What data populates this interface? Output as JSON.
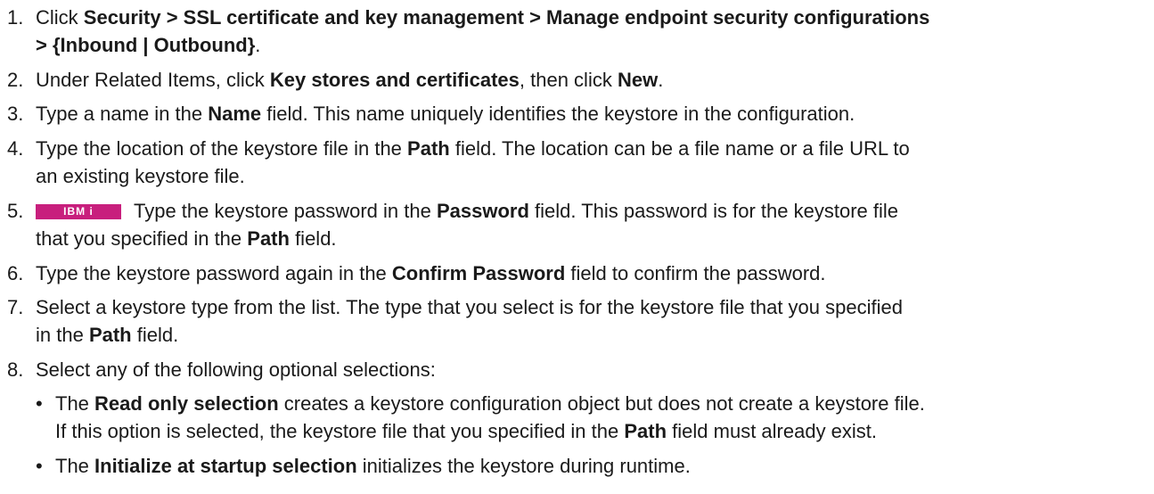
{
  "steps": [
    {
      "num": "1.",
      "parts": [
        {
          "t": "Click ",
          "b": false
        },
        {
          "t": "Security > SSL certificate and key management > Manage endpoint security configurations",
          "b": true
        }
      ],
      "line2": [
        {
          "t": "> {Inbound | Outbound}",
          "b": true
        },
        {
          "t": ".",
          "b": false
        }
      ]
    },
    {
      "num": "2.",
      "parts": [
        {
          "t": "Under Related Items, click ",
          "b": false
        },
        {
          "t": "Key stores and certificates",
          "b": true
        },
        {
          "t": ", then click ",
          "b": false
        },
        {
          "t": "New",
          "b": true
        },
        {
          "t": ".",
          "b": false
        }
      ]
    },
    {
      "num": "3.",
      "parts": [
        {
          "t": "Type a name in the ",
          "b": false
        },
        {
          "t": "Name",
          "b": true
        },
        {
          "t": " field. This name uniquely identifies the keystore in the configuration.",
          "b": false
        }
      ]
    },
    {
      "num": "4.",
      "parts": [
        {
          "t": "Type the location of the keystore file in the ",
          "b": false
        },
        {
          "t": "Path",
          "b": true
        },
        {
          "t": " field. The location can be a file name or a file URL to",
          "b": false
        }
      ],
      "line2": [
        {
          "t": "an existing keystore file.",
          "b": false
        }
      ]
    },
    {
      "num": "5.",
      "badge": "IBM i",
      "parts": [
        {
          "t": "Type the keystore password in the ",
          "b": false
        },
        {
          "t": "Password",
          "b": true
        },
        {
          "t": " field. This password is for the keystore file",
          "b": false
        }
      ],
      "line2": [
        {
          "t": "that you specified in the ",
          "b": false
        },
        {
          "t": "Path",
          "b": true
        },
        {
          "t": " field.",
          "b": false
        }
      ]
    },
    {
      "num": "6.",
      "parts": [
        {
          "t": "Type the keystore password again in the ",
          "b": false
        },
        {
          "t": "Confirm Password",
          "b": true
        },
        {
          "t": " field to confirm the password.",
          "b": false
        }
      ]
    },
    {
      "num": "7.",
      "parts": [
        {
          "t": "Select a keystore type from the list. The type that you select is for the keystore file that you specified",
          "b": false
        }
      ],
      "line2": [
        {
          "t": "in the ",
          "b": false
        },
        {
          "t": "Path",
          "b": true
        },
        {
          "t": " field.",
          "b": false
        }
      ]
    },
    {
      "num": "8.",
      "parts": [
        {
          "t": "Select any of the following optional selections:",
          "b": false
        }
      ]
    }
  ],
  "bullets": [
    {
      "dot": "•",
      "parts": [
        {
          "t": "The ",
          "b": false
        },
        {
          "t": "Read only selection",
          "b": true
        },
        {
          "t": " creates a keystore configuration object but does not create a keystore file.",
          "b": false
        }
      ],
      "line2": [
        {
          "t": "If this option is selected, the keystore file that you specified in the ",
          "b": false
        },
        {
          "t": "Path",
          "b": true
        },
        {
          "t": " field must already exist.",
          "b": false
        }
      ]
    },
    {
      "dot": "•",
      "parts": [
        {
          "t": "The ",
          "b": false
        },
        {
          "t": "Initialize at startup selection",
          "b": true
        },
        {
          "t": " initializes the keystore during runtime.",
          "b": false
        }
      ]
    }
  ]
}
